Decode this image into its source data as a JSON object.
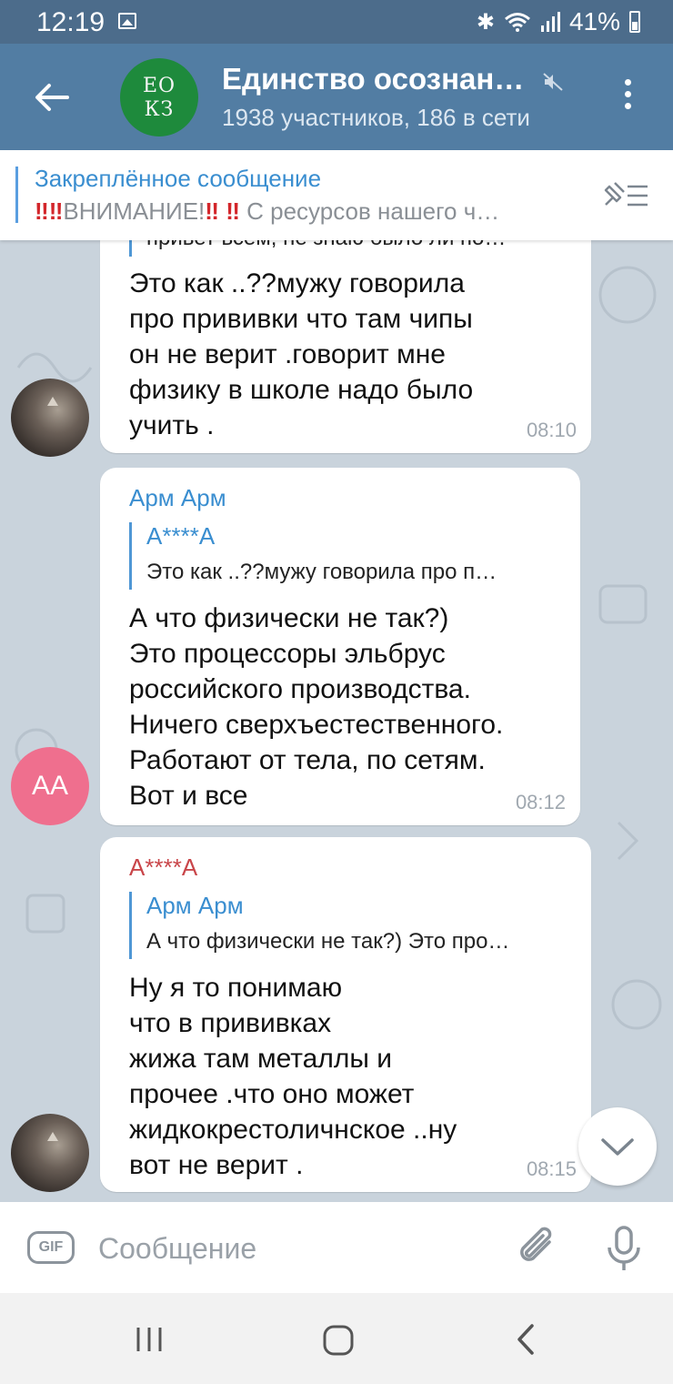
{
  "status_bar": {
    "time": "12:19",
    "battery": "41%",
    "icons": [
      "image-icon",
      "bluetooth-icon",
      "wifi-icon",
      "signal-icon",
      "battery-icon"
    ]
  },
  "header": {
    "avatar_line1": "EO",
    "avatar_line2": "КЗ",
    "title": "Единство осознан…",
    "subtitle": "1938 участников, 186 в сети",
    "icons": [
      "back-arrow-icon",
      "mute-icon",
      "more-vert-icon"
    ]
  },
  "pinned": {
    "title": "Закреплённое сообщение",
    "emphasis_left": "‼‼",
    "word": "ВНИМАНИЕ!",
    "emphasis_right": "‼ ‼",
    "rest": " С ресурсов нашего ч…"
  },
  "messages": [
    {
      "id": "msg1",
      "cut_quote": "привет всем, не знаю было ли по…",
      "text": "Это как ..??мужу говорила\nпро прививки что там чипы\nон не верит .говорит мне\nфизику в школе надо было\nучить .",
      "time": "08:10"
    },
    {
      "id": "msg2",
      "sender": "Арм Арм",
      "quote_name": "А****А",
      "quote_text": "Это как ..??мужу говорила про п…",
      "text": "А что физически не так?)\nЭто процессоры эльбрус\nроссийского производства.\nНичего сверхъестественного.\nРаботают от тела, по сетям.\nВот и все",
      "time": "08:12",
      "avatar_initials": "АА"
    },
    {
      "id": "msg3",
      "sender": "А****А",
      "quote_name": "Арм Арм",
      "quote_text": "А что физически не так?) Это про…",
      "text": "Ну я то понимаю\nчто в прививках\nжижа там металлы и\nпрочее .что оно может\nжидкокрестоличнское ..ну\nвот не верит .",
      "time": "08:15"
    }
  ],
  "composer": {
    "gif_label": "GIF",
    "placeholder": "Сообщение"
  },
  "colors": {
    "header": "#527da3",
    "status_bar": "#4c6c8b",
    "chat_bg": "#c9d3dc",
    "link_blue": "#3a8ed0",
    "sender_red": "#c9464a",
    "avatar_pink": "#ef6f8e"
  }
}
